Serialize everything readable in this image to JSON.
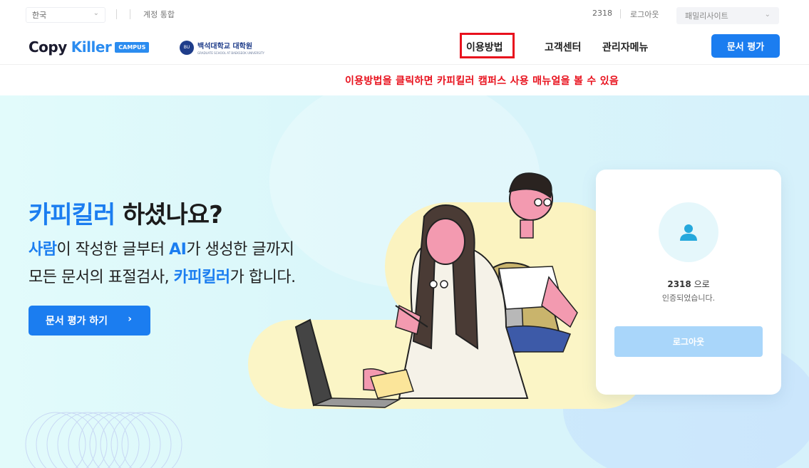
{
  "util_bar": {
    "language": "한국",
    "account_link": "계정 통합",
    "user_id": "2318",
    "logout": "로그아웃",
    "family_site": "패밀리사이트"
  },
  "header": {
    "logo_copy": "Copy",
    "logo_killer": "Killer",
    "logo_campus": "CAMPUS",
    "university_name": "백석대학교 대학원",
    "university_sub": "GRADUATE SCHOOL AT BAEKSEOK UNIVERSITY",
    "nav": {
      "guide": "이용방법",
      "support": "고객센터",
      "admin": "관리자메뉴"
    },
    "eval_button": "문서 평가"
  },
  "annotation": "이용방법을 클릭하면 카피킬러 캠퍼스 사용 매뉴얼을 볼 수 있음",
  "hero": {
    "title_accent": "카피킬러",
    "title_rest": " 하셨나요?",
    "line1_a": "사람",
    "line1_b": "이 작성한 글부터 ",
    "line1_c": "AI",
    "line1_d": "가 생성한 글까지",
    "line2_a": "모든 문서의 표절검사, ",
    "line2_b": "카피킬러",
    "line2_c": "가 합니다.",
    "button": "문서 평가 하기"
  },
  "card": {
    "user_id": "2318",
    "id_suffix": " 으로",
    "message": "인증되었습니다.",
    "logout_button": "로그아웃"
  },
  "colors": {
    "accent": "#1b7df0",
    "highlight": "#e8111d",
    "hero_bg": "#dcf7fa"
  }
}
